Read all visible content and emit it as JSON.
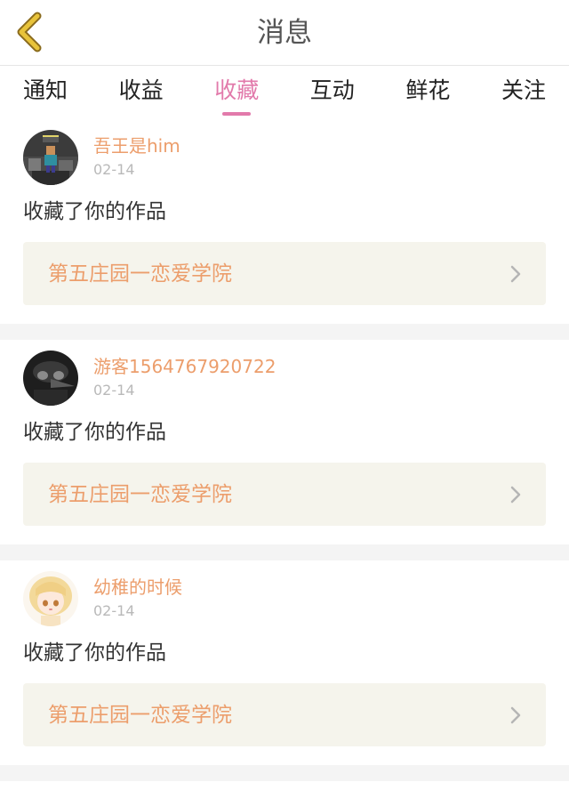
{
  "header": {
    "title": "消息",
    "back_icon": "chevron-left-icon",
    "back_color": "#e8c33a"
  },
  "tabs": [
    {
      "label": "通知",
      "active": false
    },
    {
      "label": "收益",
      "active": false
    },
    {
      "label": "收藏",
      "active": true
    },
    {
      "label": "互动",
      "active": false
    },
    {
      "label": "鲜花",
      "active": false
    },
    {
      "label": "关注",
      "active": false
    }
  ],
  "colors": {
    "accent": "#e27aab",
    "username": "#ec9e6c",
    "work_box_bg": "#f5f4ec"
  },
  "feed": {
    "items": [
      {
        "username": "吾王是him",
        "date": "02-14",
        "action": "收藏了你的作品",
        "work_title": "第五庄园一恋爱学院",
        "avatar": "minecraft-avatar"
      },
      {
        "username": "游客1564767920722",
        "date": "02-14",
        "action": "收藏了你的作品",
        "work_title": "第五庄园一恋爱学院",
        "avatar": "plague-doctor-avatar"
      },
      {
        "username": "幼稚的时候",
        "date": "02-14",
        "action": "收藏了你的作品",
        "work_title": "第五庄园一恋爱学院",
        "avatar": "anime-girl-avatar"
      }
    ]
  }
}
